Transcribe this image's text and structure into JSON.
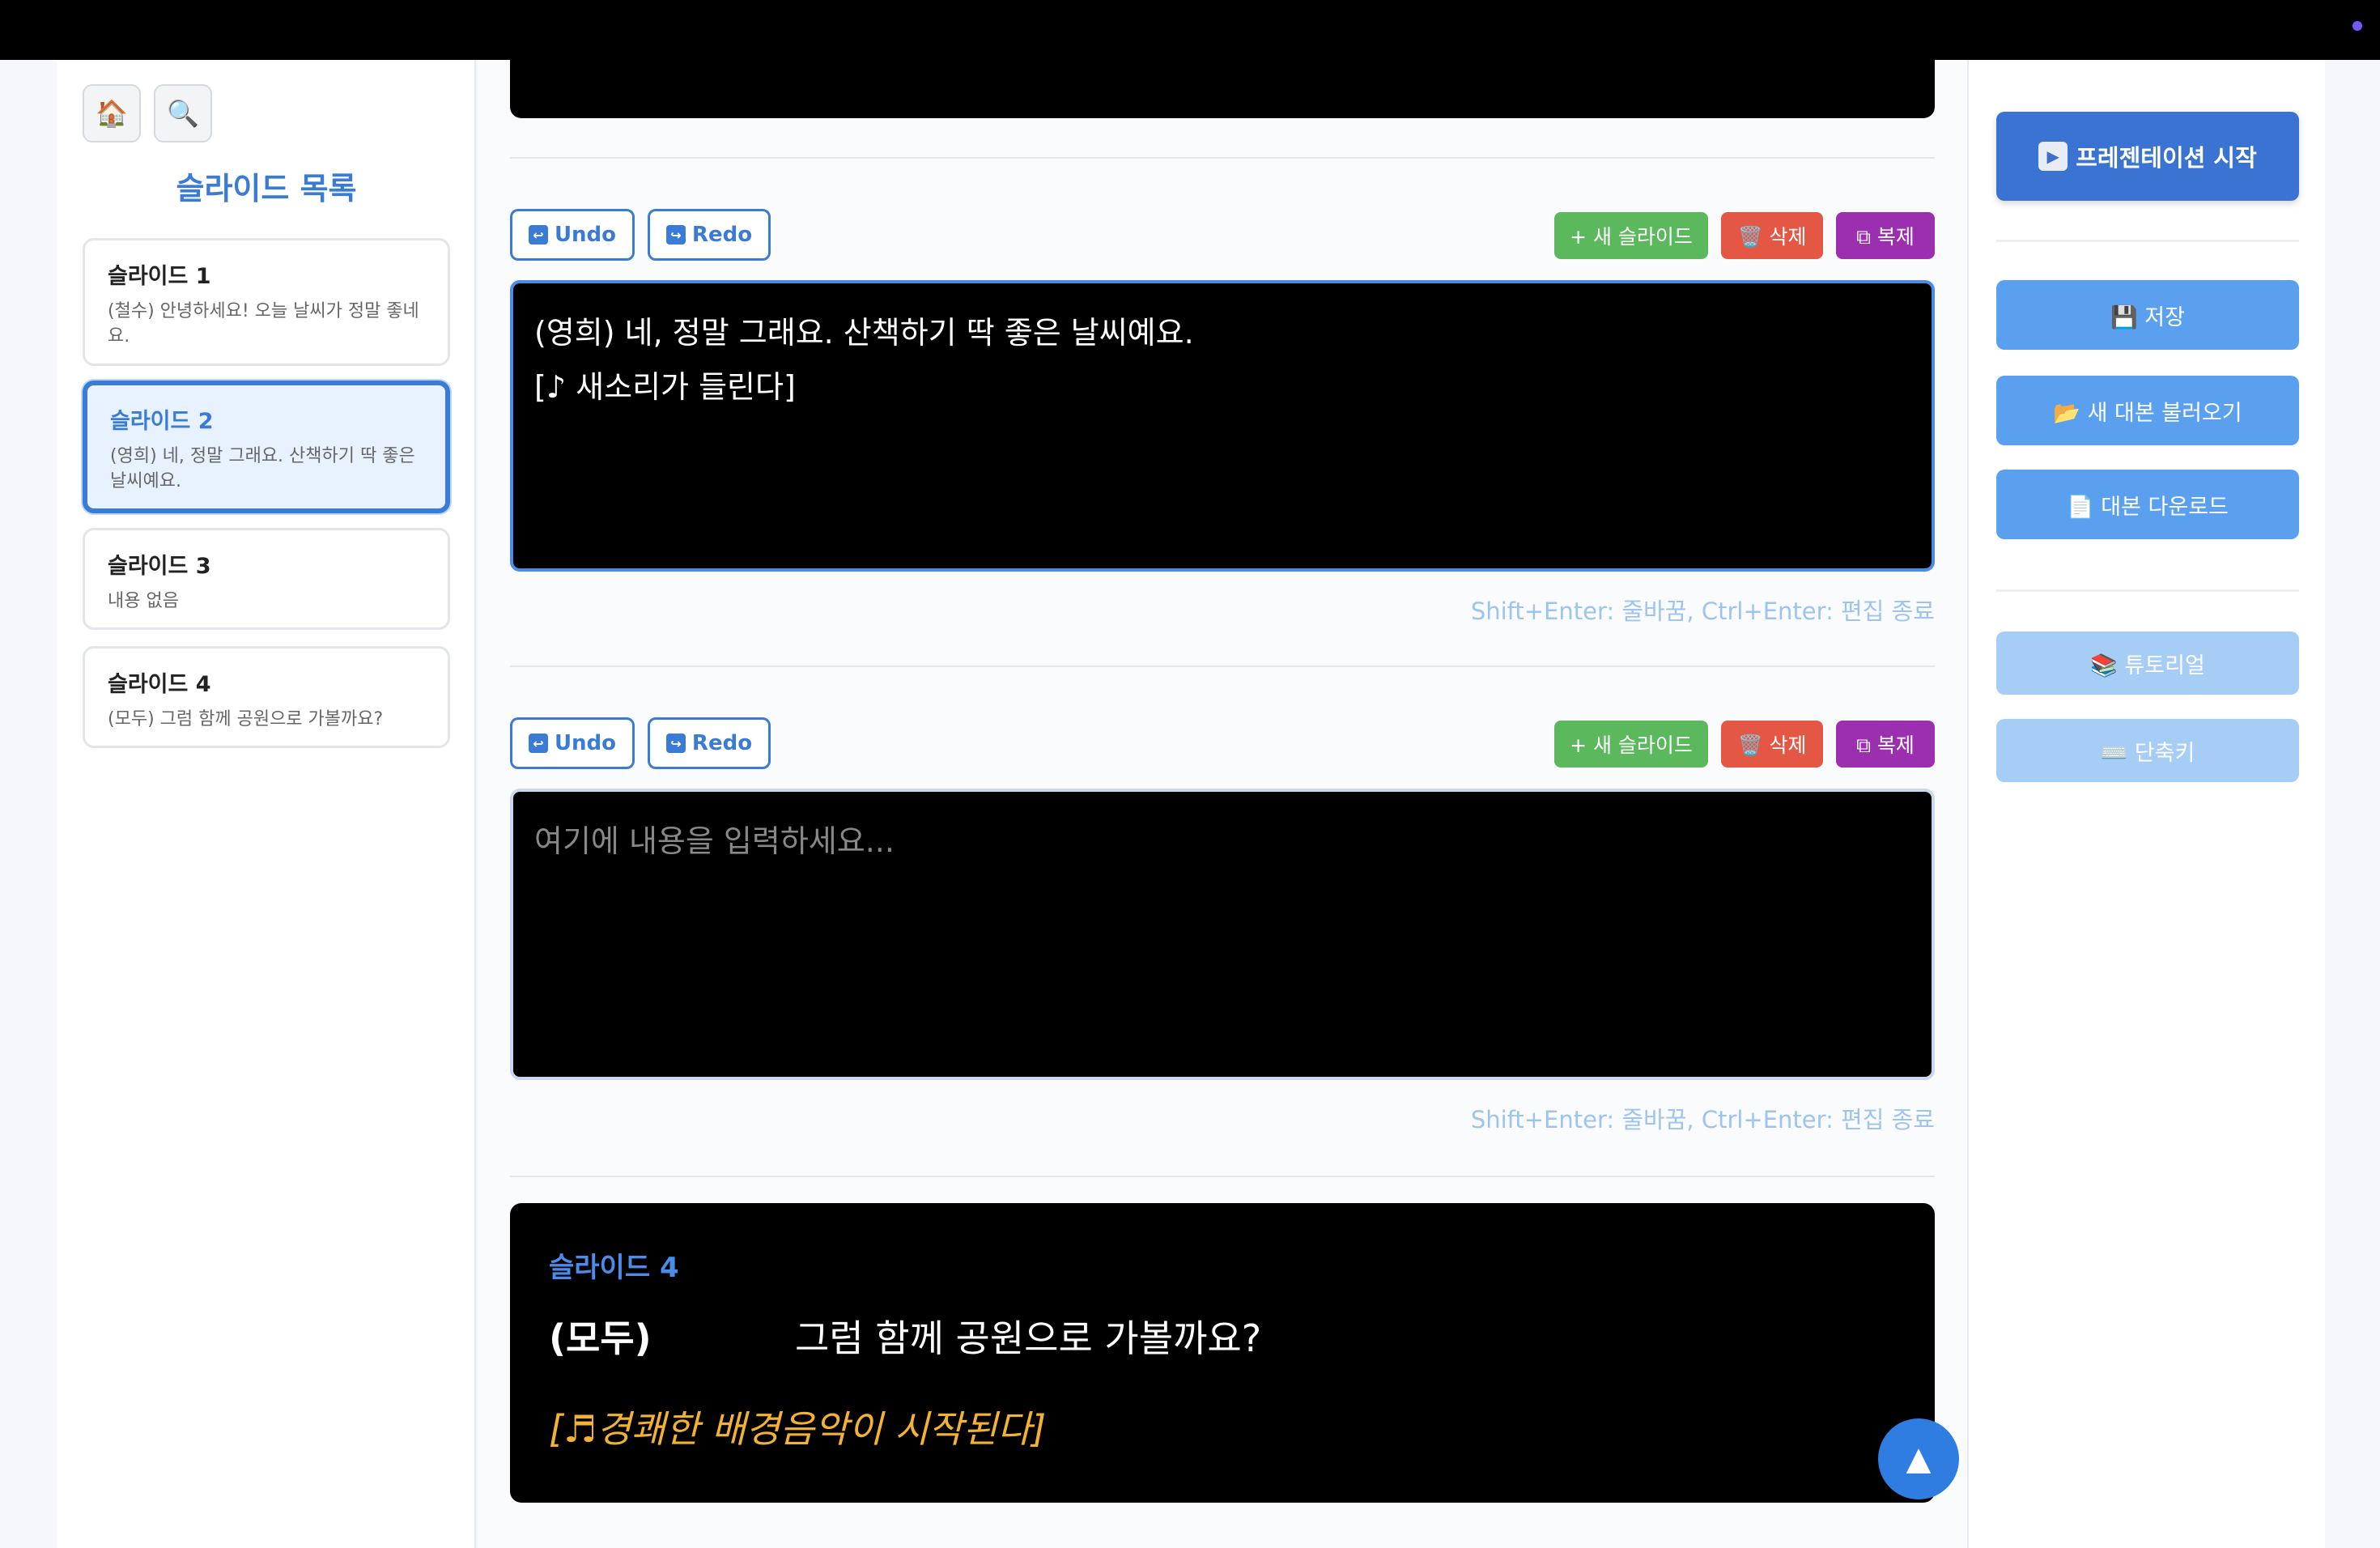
{
  "toolbar": {
    "home_icon": "🏠",
    "search_icon": "🔍"
  },
  "sidebar": {
    "title": "슬라이드 목록",
    "items": [
      {
        "title": "슬라이드 1",
        "preview": "(철수) 안녕하세요! 오늘 날씨가 정말 좋네요."
      },
      {
        "title": "슬라이드 2",
        "preview": "(영희) 네, 정말 그래요. 산책하기 딱 좋은 날씨예요."
      },
      {
        "title": "슬라이드 3",
        "preview": "내용 없음"
      },
      {
        "title": "슬라이드 4",
        "preview": "(모두) 그럼 함께 공원으로 가볼까요?"
      }
    ]
  },
  "editor1": {
    "undo": "Undo",
    "redo": "Redo",
    "new_slide": "+ 새 슬라이드",
    "delete": "🗑️ 삭제",
    "duplicate": "⧉ 복제",
    "line1": "(영희) 네, 정말 그래요. 산책하기 딱 좋은 날씨예요.",
    "line2": "[♪ 새소리가 들린다]",
    "hint": "Shift+Enter: 줄바꿈, Ctrl+Enter: 편집 종료"
  },
  "editor2": {
    "undo": "Undo",
    "redo": "Redo",
    "new_slide": "+ 새 슬라이드",
    "delete": "🗑️ 삭제",
    "duplicate": "⧉ 복제",
    "placeholder": "여기에 내용을 입력하세요...",
    "hint": "Shift+Enter: 줄바꿈, Ctrl+Enter: 편집 종료"
  },
  "preview": {
    "title": "슬라이드 4",
    "speaker": "(모두)",
    "line": "그럼 함께 공원으로 가볼까요?",
    "sfx": "[♬경쾌한 배경음악이 시작된다]"
  },
  "scroll_top": "▲",
  "right": {
    "present": "프레젠테이션 시작",
    "save": "💾 저장",
    "load": "📂 새 대본 불러오기",
    "download": "📄 대본 다운로드",
    "tutorial": "📚 튜토리얼",
    "shortcuts": "⌨️ 단축키"
  },
  "colors": {
    "accent": "#3a7bd5",
    "green": "#5cb85c",
    "red": "#e45745",
    "purple": "#9b2fb0",
    "sfx": "#f3b232"
  }
}
